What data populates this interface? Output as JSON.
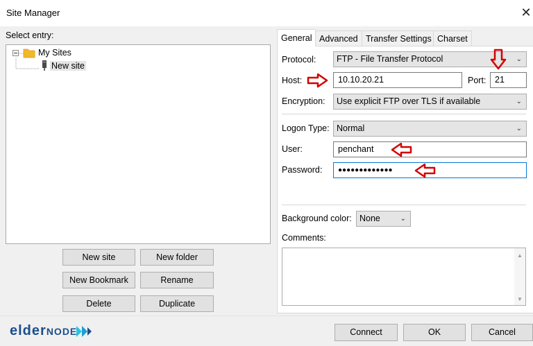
{
  "window": {
    "title": "Site Manager",
    "close_glyph": "✕"
  },
  "left": {
    "select_label": "Select entry:",
    "tree": [
      {
        "label": "My Sites",
        "icon": "folder-icon"
      },
      {
        "label": "New site",
        "icon": "server-icon"
      }
    ],
    "buttons": {
      "new_site": "New site",
      "new_folder": "New folder",
      "new_bookmark": "New Bookmark",
      "rename": "Rename",
      "delete": "Delete",
      "duplicate": "Duplicate"
    }
  },
  "tabs": [
    "General",
    "Advanced",
    "Transfer Settings",
    "Charset"
  ],
  "general": {
    "protocol_label": "Protocol:",
    "protocol_value": "FTP - File Transfer Protocol",
    "host_label": "Host:",
    "host_value": "10.10.20.21",
    "port_label": "Port:",
    "port_value": "21",
    "encryption_label": "Encryption:",
    "encryption_value": "Use explicit FTP over TLS if available",
    "logon_label": "Logon Type:",
    "logon_value": "Normal",
    "user_label": "User:",
    "user_value": "penchant",
    "password_label": "Password:",
    "password_value": "●●●●●●●●●●●●●",
    "bgcolor_label": "Background color:",
    "bgcolor_value": "None",
    "comments_label": "Comments:"
  },
  "footer": {
    "logo_text_1": "elder",
    "logo_text_2": "node",
    "connect": "Connect",
    "ok": "OK",
    "cancel": "Cancel"
  },
  "colors": {
    "annotation_arrow": "#d40000",
    "logo_blue": "#1a4e8c",
    "logo_cyan": "#27c3e0",
    "focus_border": "#0078d7"
  }
}
